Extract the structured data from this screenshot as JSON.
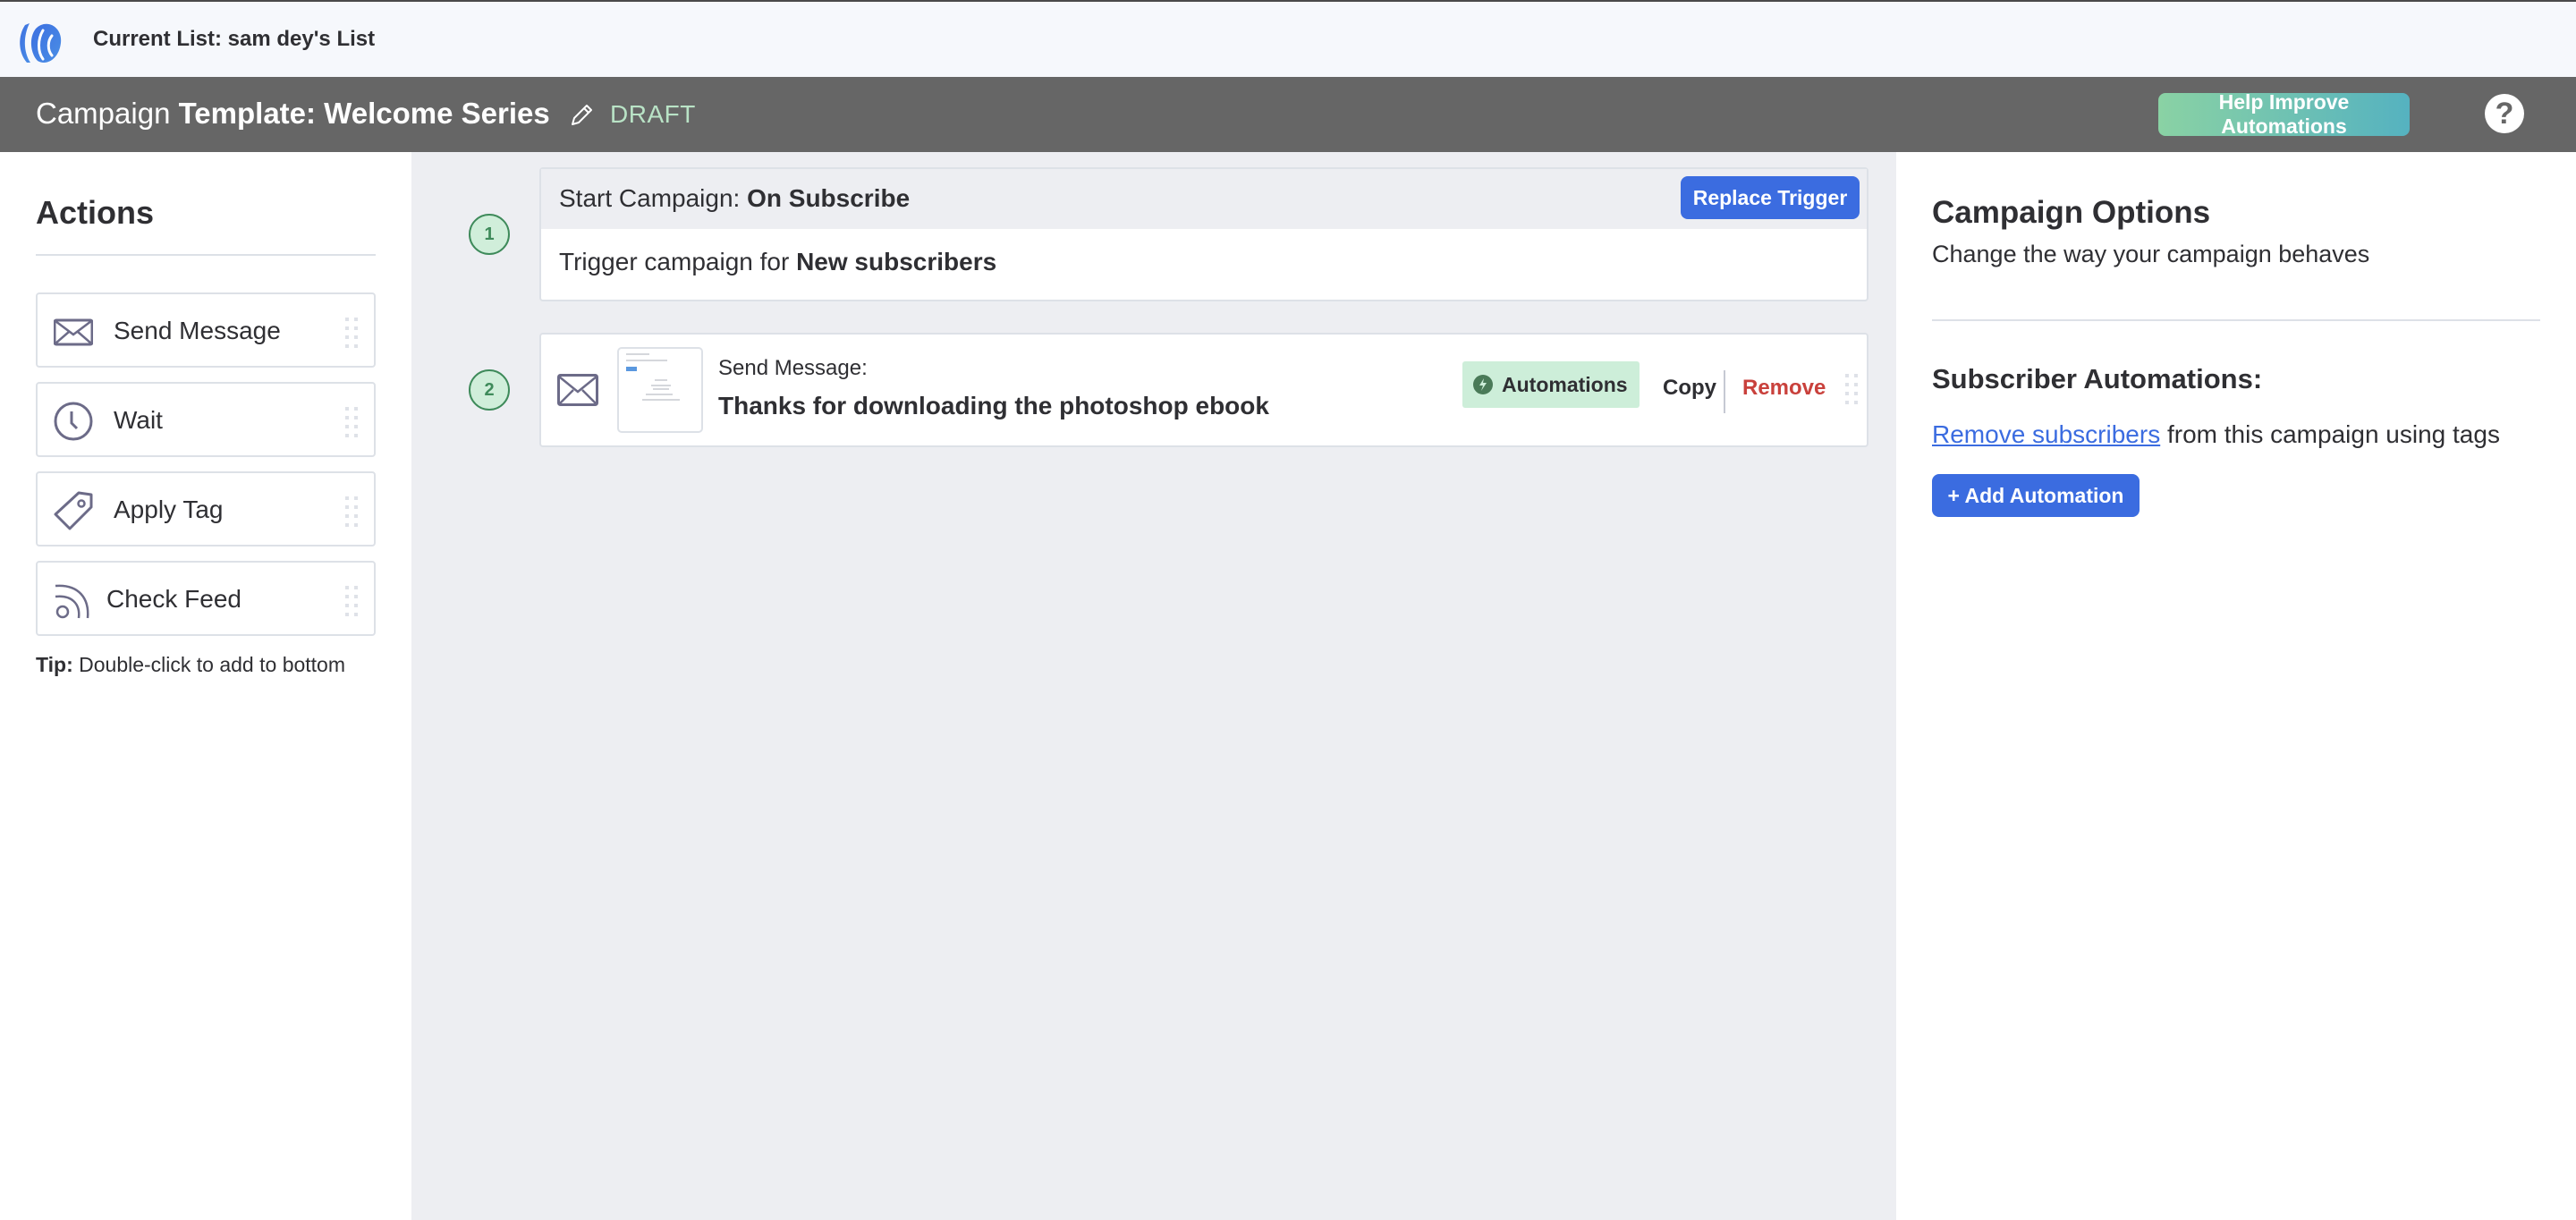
{
  "topbar": {
    "logo": "app-logo",
    "current_list": "Current List: sam dey's List"
  },
  "header": {
    "title_prefix": "Campaign",
    "title_name": "Template: Welcome Series",
    "edit_icon": "pencil-icon",
    "status": "DRAFT",
    "help_button": "Help Improve Automations",
    "help_icon": "question-icon"
  },
  "actions_panel": {
    "title": "Actions",
    "items": [
      {
        "label": "Send Message",
        "icon": "envelope-icon"
      },
      {
        "label": "Wait",
        "icon": "clock-icon"
      },
      {
        "label": "Apply Tag",
        "icon": "tag-icon"
      },
      {
        "label": "Check Feed",
        "icon": "rss-feed-icon"
      }
    ],
    "tip_label": "Tip:",
    "tip_text": " Double-click to add to bottom"
  },
  "workflow": {
    "steps": [
      {
        "number": "1",
        "header_prefix": "Start Campaign: ",
        "header_value": "On Subscribe",
        "action_button": "Replace Trigger",
        "body_prefix": "Trigger campaign for ",
        "body_value": "New subscribers"
      },
      {
        "number": "2",
        "label": "Send Message:",
        "title": "Thanks for downloading the photoshop ebook",
        "badge": "Automations",
        "copy": "Copy",
        "remove": "Remove"
      }
    ]
  },
  "options_panel": {
    "title": "Campaign Options",
    "subtitle": "Change the way your campaign behaves",
    "automations_title": "Subscriber Automations:",
    "link_text": "Remove subscribers",
    "link_suffix": " from this campaign using tags",
    "add_button": "+ Add Automation"
  },
  "colors": {
    "primary": "#3b6ce0",
    "header_bg": "#666666",
    "draft": "#b9e3c6",
    "success_bg": "#cdeed9",
    "step_border": "#3e8a5a",
    "danger": "#c9413c",
    "canvas_bg": "#edeef2"
  }
}
